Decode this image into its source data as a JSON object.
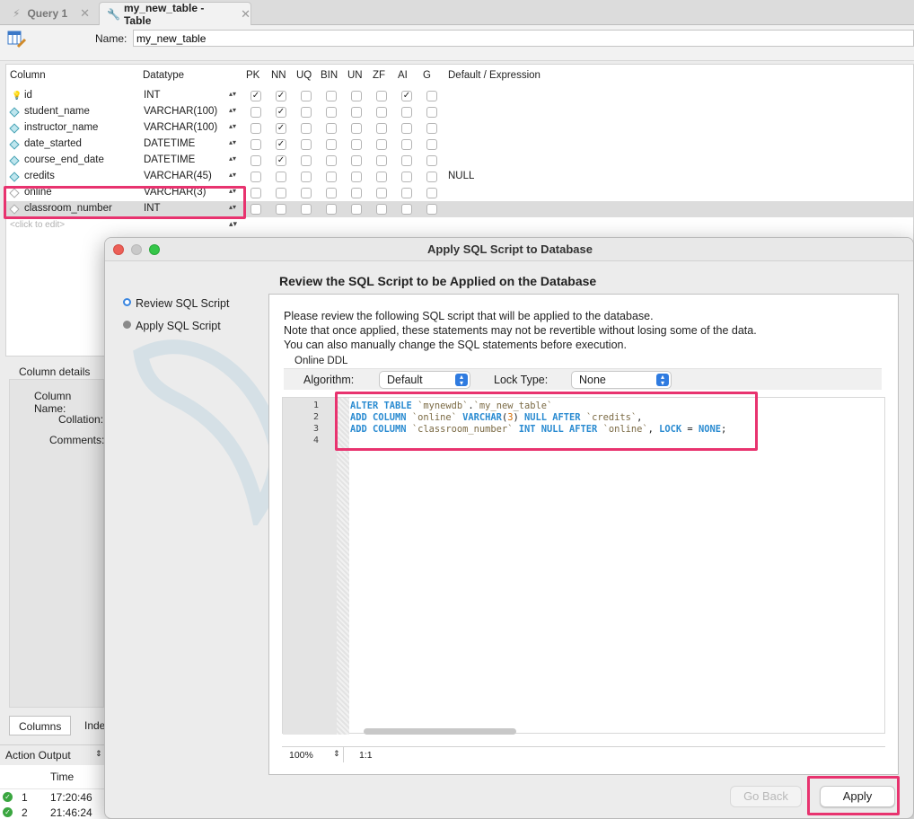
{
  "tabs": [
    {
      "label": "Query 1",
      "active": false
    },
    {
      "label": "my_new_table - Table",
      "active": true
    }
  ],
  "name_label": "Name:",
  "name_value": "my_new_table",
  "grid": {
    "headers": [
      "Column",
      "Datatype",
      "PK",
      "NN",
      "UQ",
      "BIN",
      "UN",
      "ZF",
      "AI",
      "G",
      "Default / Expression"
    ],
    "rows": [
      {
        "name": "id",
        "type": "INT",
        "pk": true,
        "nn": true,
        "ai": true,
        "default": "",
        "icon": "key-icon"
      },
      {
        "name": "student_name",
        "type": "VARCHAR(100)",
        "pk": false,
        "nn": true,
        "ai": false,
        "default": "",
        "icon": "column-icon"
      },
      {
        "name": "instructor_name",
        "type": "VARCHAR(100)",
        "pk": false,
        "nn": true,
        "ai": false,
        "default": "",
        "icon": "column-icon"
      },
      {
        "name": "date_started",
        "type": "DATETIME",
        "pk": false,
        "nn": true,
        "ai": false,
        "default": "",
        "icon": "column-icon"
      },
      {
        "name": "course_end_date",
        "type": "DATETIME",
        "pk": false,
        "nn": true,
        "ai": false,
        "default": "",
        "icon": "column-icon"
      },
      {
        "name": "credits",
        "type": "VARCHAR(45)",
        "pk": false,
        "nn": false,
        "ai": false,
        "default": "NULL",
        "icon": "column-icon"
      },
      {
        "name": "online",
        "type": "VARCHAR(3)",
        "pk": false,
        "nn": false,
        "ai": false,
        "default": "",
        "icon": "nullable-column-icon"
      },
      {
        "name": "classroom_number",
        "type": "INT",
        "pk": false,
        "nn": false,
        "ai": false,
        "default": "",
        "icon": "nullable-column-icon"
      }
    ],
    "new_row_placeholder": "<click to edit>"
  },
  "details": {
    "title": "Column details 'cla",
    "column_name_label": "Column Name:",
    "collation_label": "Collation:",
    "comments_label": "Comments:"
  },
  "bottom_tabs": [
    "Columns",
    "Inde"
  ],
  "action_output": {
    "label": "Action Output",
    "time_header": "Time",
    "rows": [
      {
        "num": "1",
        "time": "17:20:46"
      },
      {
        "num": "2",
        "time": "21:46:24"
      }
    ]
  },
  "dialog": {
    "title": "Apply SQL Script to Database",
    "steps": [
      "Review SQL Script",
      "Apply SQL Script"
    ],
    "heading": "Review the SQL Script to be Applied on the Database",
    "description": [
      "Please review the following SQL script that will be applied to the database.",
      "Note that once applied, these statements may not be revertible without losing some of the data.",
      "You can also manually change the SQL statements before execution."
    ],
    "online_ddl_legend": "Online DDL",
    "algorithm_label": "Algorithm:",
    "algorithm_value": "Default",
    "lock_type_label": "Lock Type:",
    "lock_type_value": "None",
    "line_numbers": [
      "1",
      "2",
      "3",
      "4"
    ],
    "zoom": "100%",
    "cursor_pos": "1:1",
    "go_back_label": "Go Back",
    "apply_label": "Apply"
  },
  "sql_tokens": {
    "l1": [
      "ALTER TABLE",
      " ",
      "`mynewdb`",
      ".",
      "`my_new_table`"
    ],
    "l2": [
      "ADD COLUMN",
      " ",
      "`online`",
      " ",
      "VARCHAR",
      "(",
      "3",
      ")",
      " ",
      "NULL AFTER",
      " ",
      "`credits`",
      ","
    ],
    "l3": [
      "ADD COLUMN",
      " ",
      "`classroom_number`",
      " ",
      "INT NULL AFTER",
      " ",
      "`online`",
      ", ",
      "LOCK",
      " = ",
      "NONE",
      ";"
    ]
  },
  "colors": {
    "highlight": "#e8336f",
    "keyword": "#2a8bd1",
    "accent": "#2f7be0"
  }
}
